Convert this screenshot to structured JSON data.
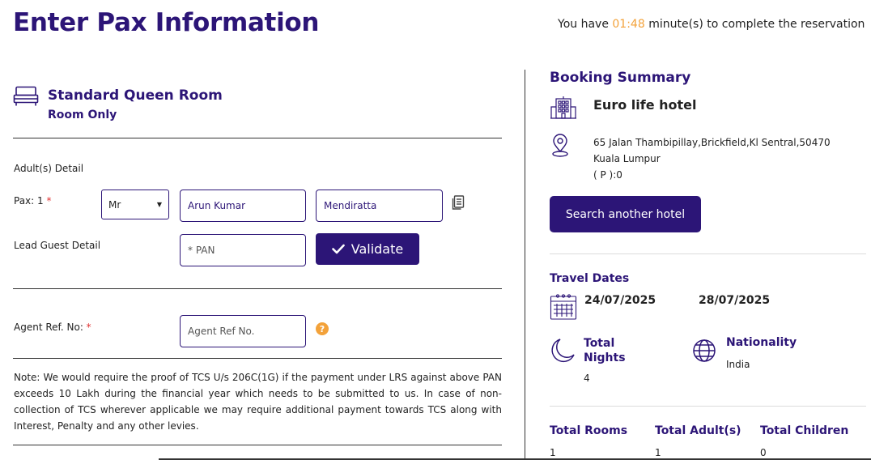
{
  "header": {
    "title": "Enter Pax Information",
    "timer_prefix": "You have ",
    "timer_value": "01:48",
    "timer_suffix": " minute(s) to complete the reservation"
  },
  "room": {
    "name": "Standard Queen Room",
    "plan": "Room Only"
  },
  "pax": {
    "section_label": "Adult(s) Detail",
    "pax_label": "Pax: 1 ",
    "required_mark": "*",
    "title_value": "Mr",
    "first_name": "Arun Kumar",
    "last_name": "Mendiratta",
    "lead_guest_label": "Lead Guest Detail",
    "pan_placeholder": "* PAN",
    "validate_label": "Validate"
  },
  "agent": {
    "label": "Agent Ref. No: ",
    "required_mark": "*",
    "placeholder": "Agent Ref No.",
    "help_glyph": "?"
  },
  "note": "Note: We would require the proof of TCS U/s 206C(1G) if the payment under LRS against above PAN exceeds 10 Lakh during the financial year which needs to be submitted to us. In case of non-collection of TCS wherever applicable we may require additional payment towards TCS along with Interest, Penalty and any other levies.",
  "summary": {
    "title": "Booking Summary",
    "hotel_name": "Euro life hotel",
    "address_line1": "65 Jalan Thambipillay,Brickfield,Kl Sentral,50470",
    "address_line2": "Kuala Lumpur",
    "phone": "( P ):0",
    "search_button": "Search another hotel",
    "travel_dates_label": "Travel Dates",
    "checkin": "24/07/2025",
    "checkout": "28/07/2025",
    "nights_label_1": "Total",
    "nights_label_2": "Nights",
    "nights_value": "4",
    "nationality_label": "Nationality",
    "nationality_value": "India",
    "rooms_label": "Total Rooms",
    "rooms_value": "1",
    "adults_label": "Total Adult(s)",
    "adults_value": "1",
    "children_label": "Total Children",
    "children_value": "0"
  },
  "colors": {
    "brand": "#2c1577",
    "timer": "#f3a23a",
    "required": "#e03030"
  }
}
